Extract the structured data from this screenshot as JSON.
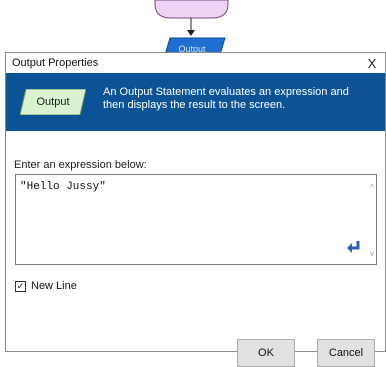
{
  "background": {
    "flow_shape_label": "Output"
  },
  "dialog": {
    "title": "Output Properties",
    "close_glyph": "X",
    "banner": {
      "shape_label": "Output",
      "description": "An Output Statement evaluates an expression and then displays the result to the screen."
    },
    "expression": {
      "prompt": "Enter an expression below:",
      "value": "\"Hello Jussy\"",
      "scroll_up_glyph": "^",
      "scroll_down_glyph": "v"
    },
    "new_line": {
      "label": "New Line",
      "checked": true,
      "check_glyph": "✓"
    },
    "buttons": {
      "ok": "OK",
      "cancel": "Cancel"
    }
  },
  "colors": {
    "banner": "#0b5394",
    "output_shape_fill": "#d9f2d0",
    "flow_output_fill": "#1f6fd0",
    "flow_terminal_fill": "#efd3f5"
  },
  "icons": [
    "close-icon",
    "enter-key-icon",
    "checkmark-icon",
    "scroll-up-arrow-icon",
    "scroll-down-arrow-icon",
    "flow-arrow-icon"
  ]
}
